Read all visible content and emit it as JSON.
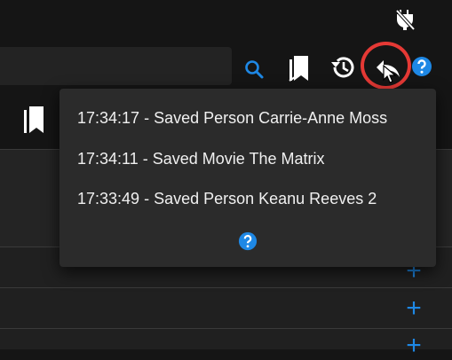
{
  "toolbar": {
    "search_value": "",
    "icons": [
      "search-icon",
      "bookmarks-icon",
      "history-icon",
      "undo-icon",
      "help-icon"
    ],
    "accent_color": "#1e88e5",
    "highlight_color": "#e53935"
  },
  "undo_menu": {
    "items": [
      "17:34:17 - Saved Person Carrie-Anne Moss",
      "17:34:11 - Saved Movie The Matrix",
      "17:33:49 - Saved Person Keanu Reeves 2"
    ],
    "help_icon": "help-icon"
  },
  "content": {
    "add_icon": "plus-icon"
  }
}
